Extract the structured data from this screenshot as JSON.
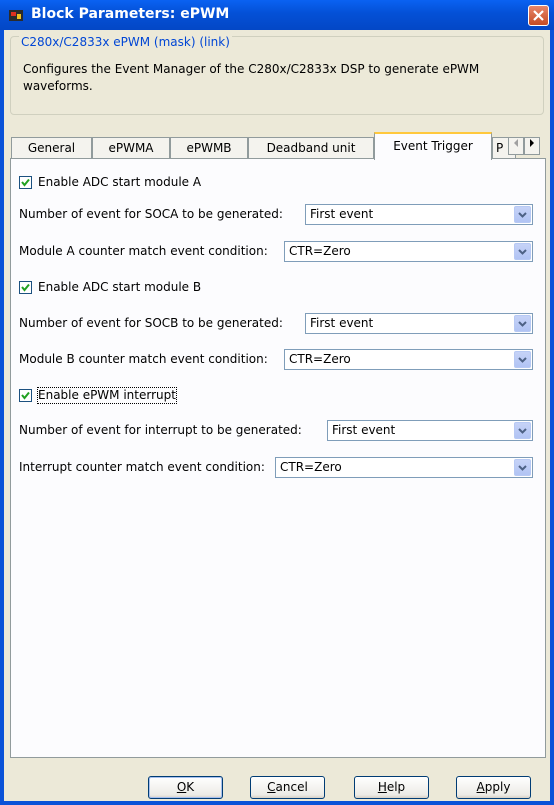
{
  "window": {
    "title": "Block Parameters: ePWM"
  },
  "mask": {
    "legend": "C280x/C2833x ePWM (mask) (link)",
    "description": "Configures the Event Manager of the C280x/C2833x DSP to generate ePWM waveforms."
  },
  "tabs": [
    {
      "label": "General"
    },
    {
      "label": "ePWMA"
    },
    {
      "label": "ePWMB"
    },
    {
      "label": "Deadband unit"
    },
    {
      "label": "Event Trigger",
      "active": true
    },
    {
      "label": "P"
    }
  ],
  "event_trigger": {
    "adc_a": {
      "label": "Enable ADC start module A",
      "checked": true
    },
    "soca_count": {
      "label": "Number of event for SOCA to be generated:",
      "value": "First event"
    },
    "a_condition": {
      "label": "Module A counter match event condition:",
      "value": "CTR=Zero"
    },
    "adc_b": {
      "label": "Enable ADC start module B",
      "checked": true
    },
    "socb_count": {
      "label": "Number of event for SOCB to be generated:",
      "value": "First event"
    },
    "b_condition": {
      "label": "Module B counter match event condition:",
      "value": "CTR=Zero"
    },
    "interrupt": {
      "label": "Enable ePWM interrupt",
      "checked": true
    },
    "int_count": {
      "label": "Number of event for interrupt to be generated:",
      "value": "First event"
    },
    "int_condition": {
      "label": "Interrupt counter match event condition:",
      "value": "CTR=Zero"
    }
  },
  "buttons": {
    "ok": {
      "label": "OK",
      "mnemonic": "O"
    },
    "cancel": {
      "label": "Cancel",
      "mnemonic": "C"
    },
    "help": {
      "label": "Help",
      "mnemonic": "H"
    },
    "apply": {
      "label": "Apply",
      "mnemonic": "A"
    }
  }
}
